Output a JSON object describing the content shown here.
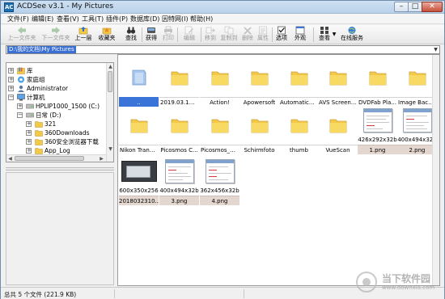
{
  "window": {
    "title": "ACDSee v3.1 - My Pictures",
    "icon_text": "AC"
  },
  "menu": [
    "文件(F)",
    "编辑(E)",
    "查看(V)",
    "工具(T)",
    "插件(P)",
    "数据库(D)",
    "因特网(I)",
    "帮助(H)"
  ],
  "toolbar": {
    "prev_folder": "上一文件夹",
    "next_folder": "下一文件夹",
    "up": "上一层",
    "favorites": "收藏夹",
    "search": "查找",
    "acquire": "获得",
    "print": "打印",
    "edit": "编辑",
    "move": "移到",
    "copy": "复制到",
    "delete": "删除",
    "properties": "属性",
    "options": "选项",
    "external": "外观",
    "view": "查看",
    "online": "在线服务"
  },
  "address": {
    "path": "D:\\我的文档\\My Pictures"
  },
  "tree": [
    {
      "label": "库",
      "icon": "library-icon",
      "expander": "+"
    },
    {
      "label": "家庭组",
      "icon": "homegroup-icon",
      "expander": "+"
    },
    {
      "label": "Administrator",
      "icon": "user-icon",
      "expander": "+"
    },
    {
      "label": "计算机",
      "icon": "computer-icon",
      "expander": "−"
    },
    {
      "label": "HPLIP1000_1500 (C:)",
      "icon": "drive-icon",
      "expander": "+"
    },
    {
      "label": "日常 (D:)",
      "icon": "drive-icon",
      "expander": "−"
    },
    {
      "label": "321",
      "icon": "folder-icon",
      "expander": "+"
    },
    {
      "label": "360Downloads",
      "icon": "folder-icon",
      "expander": "+"
    },
    {
      "label": "360安全浏览器下载",
      "icon": "folder-icon",
      "expander": "+"
    },
    {
      "label": "App_Log",
      "icon": "folder-icon",
      "expander": "+"
    }
  ],
  "folders": [
    {
      "label": "..",
      "selected": true,
      "kind": "up-folder"
    },
    {
      "label": "2019.03.18_..."
    },
    {
      "label": "Action!"
    },
    {
      "label": "Apowersoft"
    },
    {
      "label": "Automaticall..."
    },
    {
      "label": "AVS Screen ..."
    },
    {
      "label": "DVDFab Pla..."
    },
    {
      "label": "Image Back..."
    },
    {
      "label": "Nikon Trans..."
    },
    {
      "label": "Picosmos C..."
    },
    {
      "label": "Picosmos_整..."
    },
    {
      "label": "Schirmfoto"
    },
    {
      "label": "thumb"
    },
    {
      "label": "VueScan"
    }
  ],
  "images": [
    {
      "name": "1.png",
      "dims": "426x292x32b",
      "style": "dialog"
    },
    {
      "name": "2.png",
      "dims": "400x494x32b",
      "style": "dialog"
    },
    {
      "name": "2018032310...",
      "dims": "600x350x256",
      "style": "dark"
    },
    {
      "name": "3.png",
      "dims": "400x494x32b",
      "style": "dialog"
    },
    {
      "name": "4.png",
      "dims": "362x456x32b",
      "style": "dialog"
    }
  ],
  "status": {
    "text": "总共 5 个文件 (221.9 KB)"
  },
  "watermark": {
    "title": "当下软件园",
    "url": "www.downxia.com"
  },
  "colors": {
    "selection": "#3b74d9",
    "folder": "#f3c94a",
    "title_bar": "#b9d1ea"
  }
}
